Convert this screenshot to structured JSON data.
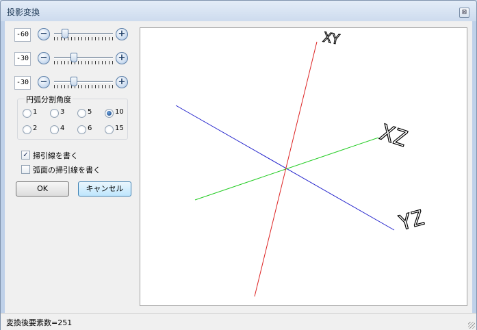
{
  "window": {
    "title": "投影変換",
    "close_glyph": "⊠"
  },
  "sliders": [
    {
      "value": "-60",
      "minus": "−",
      "plus": "+"
    },
    {
      "value": "-30",
      "minus": "−",
      "plus": "+"
    },
    {
      "value": "-30",
      "minus": "−",
      "plus": "+"
    }
  ],
  "arc_group": {
    "label": "円弧分割角度",
    "options": [
      "1",
      "3",
      "5",
      "10",
      "2",
      "4",
      "6",
      "15"
    ],
    "selected": "10"
  },
  "checkboxes": [
    {
      "label": "掃引線を書く",
      "checked": true
    },
    {
      "label": "弧面の掃引線を書く",
      "checked": false
    }
  ],
  "buttons": {
    "ok": "OK",
    "cancel": "キャンセル"
  },
  "axis_labels": {
    "xy": "XY",
    "xz": "XZ",
    "yz": "YZ"
  },
  "status": {
    "text": "変換後要素数=251"
  }
}
